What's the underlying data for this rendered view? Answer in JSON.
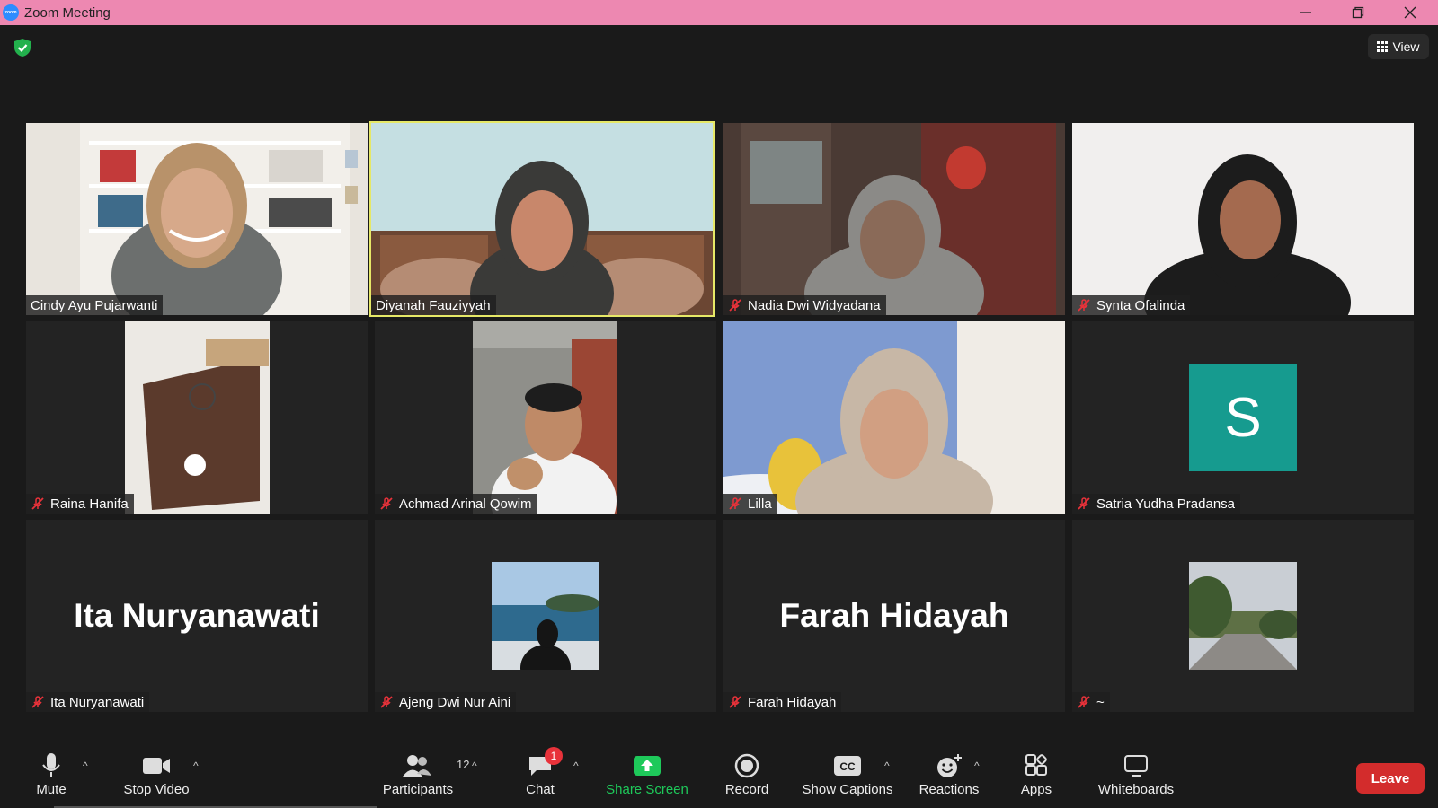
{
  "window": {
    "title": "Zoom Meeting",
    "logo_text": "zoom"
  },
  "header": {
    "view_label": "View"
  },
  "participants": [
    {
      "name": "Cindy Ayu Pujarwanti",
      "muted": false,
      "active": false
    },
    {
      "name": "Diyanah Fauziyyah",
      "muted": false,
      "active": true
    },
    {
      "name": "Nadia Dwi Widyadana",
      "muted": true,
      "active": false
    },
    {
      "name": "Synta Ofalinda",
      "muted": true,
      "active": false
    },
    {
      "name": "Raina Hanifa",
      "muted": true,
      "active": false
    },
    {
      "name": "Achmad Arinal Qowim",
      "muted": true,
      "active": false
    },
    {
      "name": "Lilla",
      "muted": true,
      "active": false
    },
    {
      "name": "Satria Yudha Pradansa",
      "muted": true,
      "active": false,
      "avatar_letter": "S",
      "avatar_color": "#169b8f"
    },
    {
      "name": "Ita Nuryanawati",
      "muted": true,
      "active": false,
      "big_name": "Ita Nuryanawati"
    },
    {
      "name": "Ajeng Dwi Nur Aini",
      "muted": true,
      "active": false
    },
    {
      "name": "Farah Hidayah",
      "muted": true,
      "active": false,
      "big_name": "Farah Hidayah"
    },
    {
      "name": "~",
      "muted": true,
      "active": false
    }
  ],
  "toolbar": {
    "mute": "Mute",
    "stop_video": "Stop Video",
    "participants": "Participants",
    "participants_count": "12",
    "chat": "Chat",
    "chat_badge": "1",
    "share_screen": "Share Screen",
    "record": "Record",
    "show_captions": "Show Captions",
    "captions_icon_text": "CC",
    "reactions": "Reactions",
    "apps": "Apps",
    "whiteboards": "Whiteboards",
    "leave": "Leave"
  },
  "colors": {
    "titlebar": "#ed88b1",
    "active_speaker": "#e6e867",
    "share_green": "#1ec95a",
    "leave_red": "#d32c2c",
    "muted_mic": "#e8323a"
  }
}
